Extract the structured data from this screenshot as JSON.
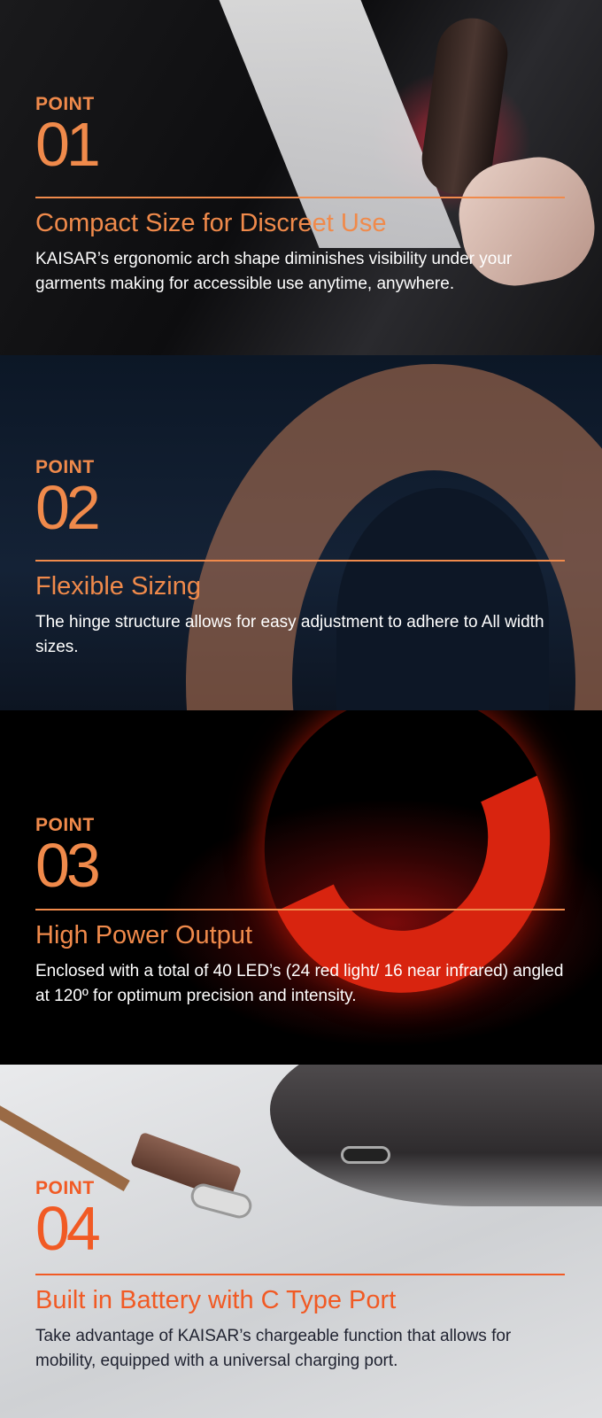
{
  "points": [
    {
      "label": "POINT",
      "number": "01",
      "title": "Compact Size for Discreet Use",
      "text": "KAISAR’s ergonomic arch shape diminishes visibility under your garments making for accessible use anytime, anywhere."
    },
    {
      "label": "POINT",
      "number": "02",
      "title": "Flexible Sizing",
      "text": "The hinge structure allows for easy adjustment to adhere to All width sizes."
    },
    {
      "label": "POINT",
      "number": "03",
      "title": "High Power Output",
      "text": "Enclosed with a total of 40 LED’s (24 red light/ 16 near infrared) angled at 120º for optimum precision and intensity."
    },
    {
      "label": "POINT",
      "number": "04",
      "title": "Built in Battery with C Type Port",
      "text": "Take advantage of KAISAR’s chargeable function that allows for mobility, equipped with a universal charging port."
    }
  ],
  "colors": {
    "accent": "#f08a4b",
    "accent_dark": "#f15a24"
  }
}
